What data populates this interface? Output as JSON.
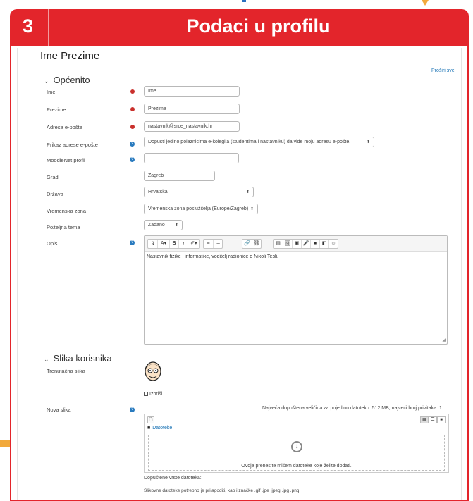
{
  "banner": {
    "number": "3",
    "title": "Podaci u profilu"
  },
  "page_title": "Ime Prezime",
  "expand_all": "Proširi sve",
  "sections": {
    "general": "Općenito",
    "user_picture": "Slika korisnika"
  },
  "fields": {
    "first_name": {
      "label": "Ime",
      "value": "Ime"
    },
    "last_name": {
      "label": "Prezime",
      "value": "Prezime"
    },
    "email": {
      "label": "Adresa e-pošte",
      "value": "nastavnik@srce_nastavnik.hr"
    },
    "email_display": {
      "label": "Prikaz adrese e-pošte",
      "value": "Dopusti jedino polaznicima e-kolegija (studentima i nastavniku) da vide moju adresu e-pošte."
    },
    "moodlenet": {
      "label": "MoodleNet profil",
      "value": ""
    },
    "city": {
      "label": "Grad",
      "value": "Zagreb"
    },
    "country": {
      "label": "Država",
      "value": "Hrvatska"
    },
    "timezone": {
      "label": "Vremenska zona",
      "value": "Vremenska zona poslužitelja (Europe/Zagreb)"
    },
    "theme": {
      "label": "Poželjna tema",
      "value": "Zadano"
    },
    "description": {
      "label": "Opis",
      "value": "Nastavnik fizike i informatike, voditelj radionice o Nikoli Tesli."
    }
  },
  "editor_toolbar": {
    "groups": [
      [
        "↴",
        "A▾",
        "B",
        "I",
        "✐▾"
      ],
      [
        "≡",
        "≔"
      ],
      [
        "🔗",
        "⛓"
      ],
      [
        "▤",
        "🖼",
        "▣",
        "🎤",
        "■",
        "◧",
        "☺"
      ]
    ]
  },
  "picture": {
    "current_label": "Trenutačna slika",
    "delete_label": "Izbriši",
    "new_label": "Nova slika",
    "limits": "Najveća dopuštena veličina za pojedinu datoteku: 512 MB, najveći broj privitaka: 1",
    "folder": "Datoteke",
    "drop_text": "Ovdje prenesite mišem datoteke koje želite dodati.",
    "allowed_types_label": "Dopuštene vrste datoteka:",
    "note": "Slikovne datoteke potrebno je prilagoditi, kao i značke .gif .jpe .jpeg .jpg .png"
  },
  "colors": {
    "accent": "#e3252b",
    "required": "#c9302c",
    "help": "#2a7bbf",
    "link": "#1a73b5"
  }
}
